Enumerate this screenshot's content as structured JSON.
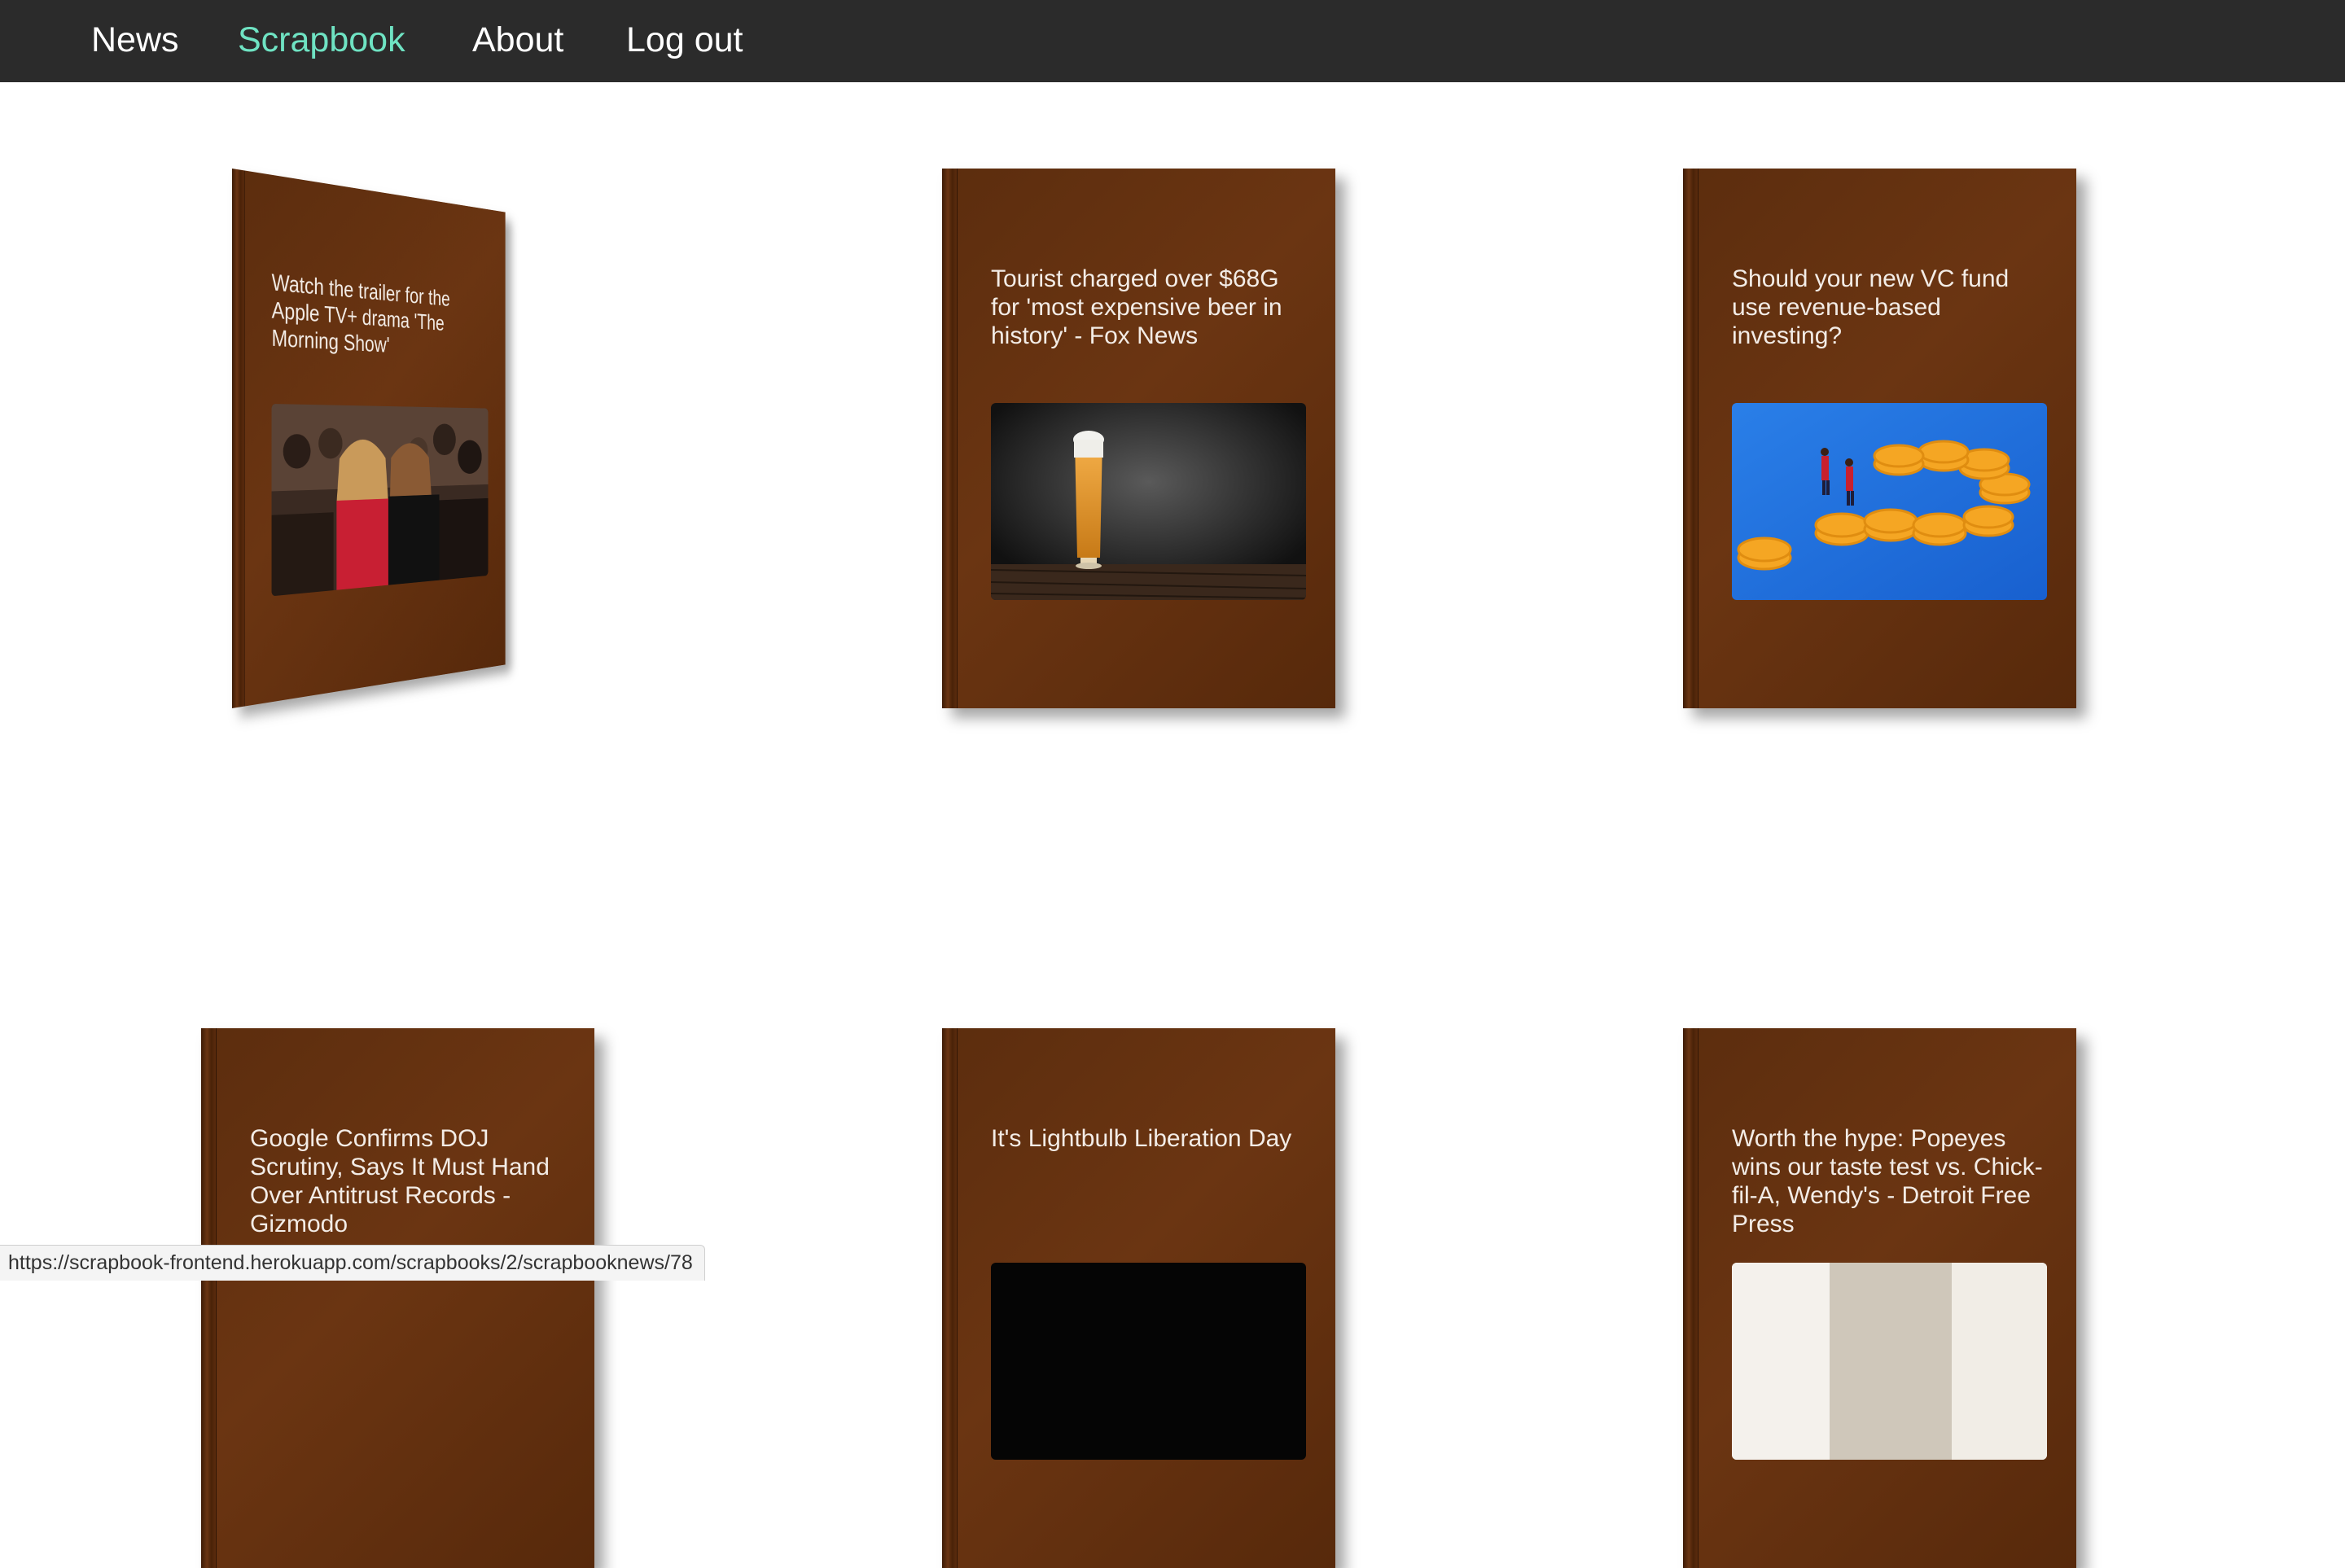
{
  "nav": {
    "items": [
      {
        "label": "News",
        "active": false
      },
      {
        "label": "Scrapbook",
        "active": true
      },
      {
        "label": "About",
        "active": false
      },
      {
        "label": "Log out",
        "active": false
      }
    ],
    "active_color": "#6fe3c3"
  },
  "scrapbook": {
    "cards": [
      {
        "title": "Watch the trailer for the Apple TV+ drama 'The Morning Show'",
        "image": "photo-red-carpet-two-women"
      },
      {
        "title": "Tourist charged over $68G for 'most expensive beer in history' - Fox News",
        "image": "photo-beer-glass"
      },
      {
        "title": "Should your new VC fund use revenue-based investing?",
        "image": "illustration-coins-blue"
      },
      {
        "title": "Google Confirms DOJ Scrutiny, Says It Must Hand Over Antitrust Records - Gizmodo",
        "image": ""
      },
      {
        "title": "It's Lightbulb Liberation Day",
        "image": "photo-dark"
      },
      {
        "title": "Worth the hype: Popeyes wins our taste test vs. Chick-fil-A, Wendy's - Detroit Free Press",
        "image": "photo-light"
      }
    ],
    "book_color": "#5c2d0e"
  },
  "status_bar": {
    "url": "https://scrapbook-frontend.herokuapp.com/scrapbooks/2/scrapbooknews/78"
  }
}
